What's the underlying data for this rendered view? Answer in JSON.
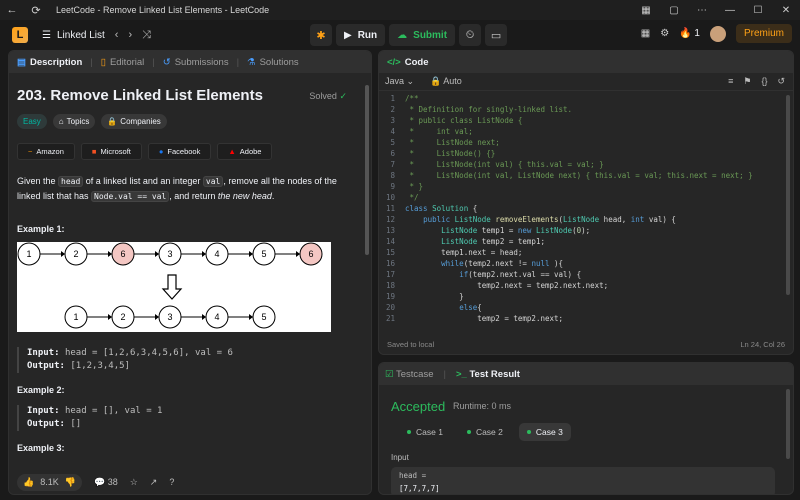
{
  "window": {
    "title": "LeetCode - Remove Linked List Elements - LeetCode"
  },
  "navbar": {
    "list_label": "Linked List",
    "run_label": "Run",
    "submit_label": "Submit",
    "streak": "1",
    "premium_label": "Premium"
  },
  "left_tabs": [
    {
      "label": "Description"
    },
    {
      "label": "Editorial"
    },
    {
      "label": "Submissions"
    },
    {
      "label": "Solutions"
    }
  ],
  "problem": {
    "title": "203. Remove Linked List Elements",
    "status": "Solved",
    "difficulty": "Easy",
    "tags_label": "Topics",
    "companies_label": "Companies",
    "companies": [
      "Amazon",
      "Microsoft",
      "Facebook",
      "Adobe"
    ],
    "text_1": "Given the ",
    "code_head": "head",
    "text_2": " of a linked list and an integer ",
    "code_val": "val",
    "text_3": ", remove all the nodes of the linked list that has ",
    "code_cond": "Node.val == val",
    "text_4": ", and return ",
    "text_em": "the new head",
    "text_5": ".",
    "diagram_top": [
      "1",
      "2",
      "6",
      "3",
      "4",
      "5",
      "6"
    ],
    "diagram_bottom": [
      "1",
      "2",
      "3",
      "4",
      "5"
    ],
    "examples": [
      {
        "title": "Example 1:",
        "input": "head = [1,2,6,3,4,5,6], val = 6",
        "output": "[1,2,3,4,5]"
      },
      {
        "title": "Example 2:",
        "input": "head = [], val = 1",
        "output": "[]"
      },
      {
        "title": "Example 3:"
      }
    ],
    "input_label": "Input:",
    "output_label": "Output:"
  },
  "footer": {
    "likes": "8.1K",
    "comments": "38"
  },
  "code": {
    "header": "Code",
    "language": "Java",
    "mode": "Auto",
    "saved": "Saved to local",
    "position": "Ln 24, Col 26",
    "lines": [
      "/**",
      " * Definition for singly-linked list.",
      " * public class ListNode {",
      " *     int val;",
      " *     ListNode next;",
      " *     ListNode() {}",
      " *     ListNode(int val) { this.val = val; }",
      " *     ListNode(int val, ListNode next) { this.val = val; this.next = next; }",
      " * }",
      " */",
      "class Solution {",
      "    public ListNode removeElements(ListNode head, int val) {",
      "        ListNode temp1 = new ListNode(0);",
      "        ListNode temp2 = temp1;",
      "        temp1.next = head;",
      "        while(temp2.next != null ){",
      "            if(temp2.next.val == val) {",
      "                temp2.next = temp2.next.next;",
      "            }",
      "            else{",
      "                temp2 = temp2.next;"
    ]
  },
  "result": {
    "testcase_label": "Testcase",
    "result_label": "Test Result",
    "status": "Accepted",
    "runtime": "Runtime: 0 ms",
    "cases": [
      "Case 1",
      "Case 2",
      "Case 3"
    ],
    "input_label": "Input",
    "input_name": "head =",
    "input_value": "[7,7,7,7]"
  },
  "colors": {
    "accent": "#ffa116",
    "accepted": "#2cbb5d",
    "easy": "#00b8a3"
  }
}
